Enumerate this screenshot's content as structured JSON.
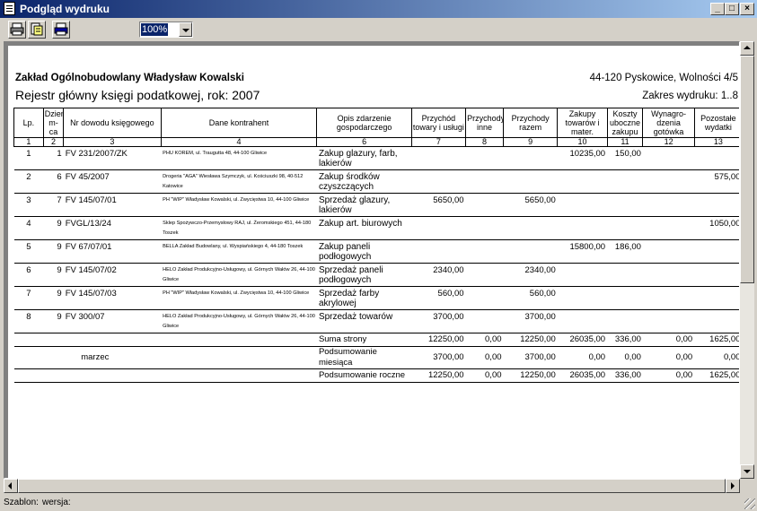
{
  "window": {
    "title": "Podgląd wydruku"
  },
  "toolbar": {
    "zoom": "100%"
  },
  "report": {
    "company": "Zakład Ogólnobudowlany  Władysław Kowalski",
    "address": "44-120 Pyskowice, Wolności 4/5",
    "title": "Rejestr główny księgi podatkowej, rok: 2007",
    "range": "Zakres wydruku: 1..8",
    "columns": [
      "Lp.",
      "Dzień m-ca",
      "Nr dowodu księgowego",
      "Dane kontrahent",
      "Opis zdarzenie gospodarczego",
      "Przychód towary i usługi",
      "Przychody inne",
      "Przychody razem",
      "Zakupy towarów i mater.",
      "Koszty uboczne zakupu",
      "Wynagro-dzenia gotówka",
      "Pozostałe wydatki"
    ],
    "column_numbers": [
      "1",
      "2",
      "3",
      "4",
      "6",
      "7",
      "8",
      "9",
      "10",
      "11",
      "12",
      "13"
    ],
    "rows": [
      {
        "lp": "1",
        "day": "1",
        "doc": "FV 231/2007/ZK",
        "contractor": "PHU KOREM, ul. Traugutta 48, 44-100 Gliwice",
        "desc": "Zakup glazury, farb, lakierów",
        "c7": "",
        "c8": "",
        "c9": "",
        "c10": "10235,00",
        "c11": "150,00",
        "c12": "",
        "c13": ""
      },
      {
        "lp": "2",
        "day": "6",
        "doc": "FV 45/2007",
        "contractor": "Drogeria \"AGA\" Wiesława Szymczyk, ul. Kościuszki 98, 40-512 Katowice",
        "desc": "Zakup środków czyszczących",
        "c7": "",
        "c8": "",
        "c9": "",
        "c10": "",
        "c11": "",
        "c12": "",
        "c13": "575,00"
      },
      {
        "lp": "3",
        "day": "7",
        "doc": "FV 145/07/01",
        "contractor": "PH \"WIP\" Władysław Kowalski, ul. Zwycięstwa 10, 44-100 Gliwice",
        "desc": "Sprzedaż glazury, lakierów",
        "c7": "5650,00",
        "c8": "",
        "c9": "5650,00",
        "c10": "",
        "c11": "",
        "c12": "",
        "c13": ""
      },
      {
        "lp": "4",
        "day": "9",
        "doc": "FVGL/13/24",
        "contractor": "Sklep Spożywczo-Przemysłowy RAJ, ul. Żeromskiego 451, 44-180 Toszek",
        "desc": "Zakup art. biurowych",
        "c7": "",
        "c8": "",
        "c9": "",
        "c10": "",
        "c11": "",
        "c12": "",
        "c13": "1050,00"
      },
      {
        "lp": "5",
        "day": "9",
        "doc": "FV 67/07/01",
        "contractor": "BELLA Zakład Budowlany, ul. Wyspiańskiego 4, 44-180 Toszek",
        "desc": "Zakup paneli podłogowych",
        "c7": "",
        "c8": "",
        "c9": "",
        "c10": "15800,00",
        "c11": "186,00",
        "c12": "",
        "c13": ""
      },
      {
        "lp": "6",
        "day": "9",
        "doc": "FV 145/07/02",
        "contractor": "HELO Zakład Produkcyjno-Usługowy, ul. Górnych Wałów 26, 44-100 Gliwice",
        "desc": "Sprzedaż paneli podłogowych",
        "c7": "2340,00",
        "c8": "",
        "c9": "2340,00",
        "c10": "",
        "c11": "",
        "c12": "",
        "c13": ""
      },
      {
        "lp": "7",
        "day": "9",
        "doc": "FV 145/07/03",
        "contractor": "PH \"WIP\" Władysław Kowalski, ul. Zwycięstwa 10, 44-100 Gliwice",
        "desc": "Sprzedaż farby akrylowej",
        "c7": "560,00",
        "c8": "",
        "c9": "560,00",
        "c10": "",
        "c11": "",
        "c12": "",
        "c13": ""
      },
      {
        "lp": "8",
        "day": "9",
        "doc": "FV 300/07",
        "contractor": "HELO Zakład Produkcyjno-Usługowy, ul. Górnych Wałów 26, 44-100 Gliwice",
        "desc": "Sprzedaż towarów",
        "c7": "3700,00",
        "c8": "",
        "c9": "3700,00",
        "c10": "",
        "c11": "",
        "c12": "",
        "c13": ""
      }
    ],
    "summaries": [
      {
        "month": "",
        "label": "Suma strony",
        "c7": "12250,00",
        "c8": "0,00",
        "c9": "12250,00",
        "c10": "26035,00",
        "c11": "336,00",
        "c12": "0,00",
        "c13": "1625,00"
      },
      {
        "month": "marzec",
        "label": "Podsumowanie miesiąca",
        "c7": "3700,00",
        "c8": "0,00",
        "c9": "3700,00",
        "c10": "0,00",
        "c11": "0,00",
        "c12": "0,00",
        "c13": "0,00"
      },
      {
        "month": "",
        "label": "Podsumowanie roczne",
        "c7": "12250,00",
        "c8": "0,00",
        "c9": "12250,00",
        "c10": "26035,00",
        "c11": "336,00",
        "c12": "0,00",
        "c13": "1625,00"
      }
    ]
  },
  "status": {
    "szablon": "Szablon:",
    "wersja": "wersja:"
  }
}
